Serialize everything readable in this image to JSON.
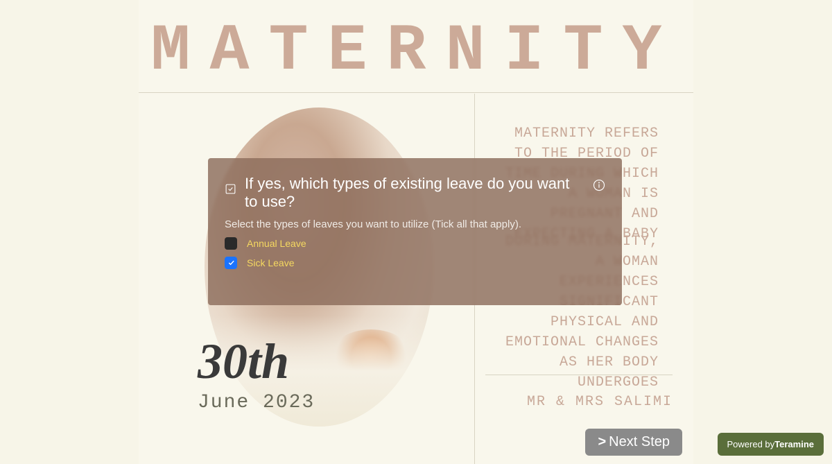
{
  "header": {
    "title": "MATERNITY"
  },
  "background": {
    "paragraph1": "MATERNITY REFERS TO THE PERIOD OF TIME DURING WHICH A WOMAN IS PREGNANT AND EXPECTING A BABY",
    "paragraph2": "DURING MATERNITY, A WOMAN EXPERIENCES SIGNIFICANT PHYSICAL AND EMOTIONAL CHANGES AS HER BODY UNDERGOES",
    "date_day": "30th",
    "date_month": "June 2023",
    "signature": "MR & MRS SALIMI"
  },
  "modal": {
    "question": "If yes, which types of existing leave do you want to use?",
    "instruction": "Select the types of leaves you want to utilize (Tick all that apply).",
    "options": [
      {
        "label": "Annual Leave",
        "checked": false
      },
      {
        "label": "Sick Leave",
        "checked": true
      }
    ]
  },
  "footer": {
    "next_label": "Next Step",
    "powered_prefix": "Powered by",
    "powered_brand": "Teramine"
  }
}
